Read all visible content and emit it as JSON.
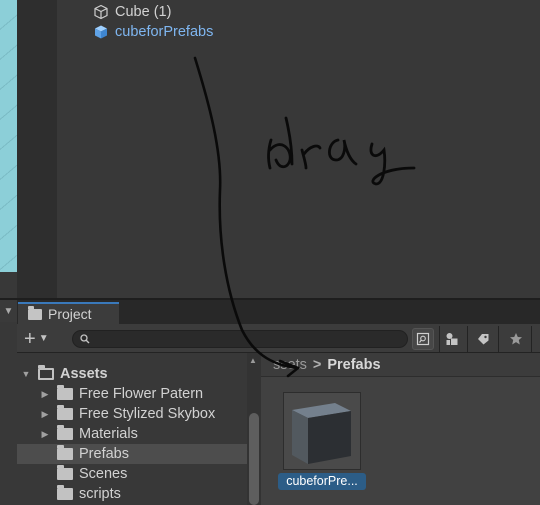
{
  "hierarchy": {
    "items": [
      {
        "label": "Cube (1)",
        "icon": "cube-outline-icon"
      },
      {
        "label": "cubeforPrefabs",
        "icon": "prefab-cube-icon",
        "color": "#7fb6f0"
      }
    ]
  },
  "annotation": {
    "text": "drag",
    "note": "hand-drawn arrow from hierarchy item to Prefabs folder"
  },
  "project": {
    "tab_label": "Project",
    "search_placeholder": "",
    "tree": [
      {
        "label": "Assets",
        "expanded": true
      },
      {
        "label": "Free Flower Patern"
      },
      {
        "label": "Free Stylized Skybox"
      },
      {
        "label": "Materials"
      },
      {
        "label": "Prefabs",
        "selected": true
      },
      {
        "label": "Scenes"
      },
      {
        "label": "scripts"
      }
    ],
    "breadcrumb": {
      "parent": "Assets",
      "visible_parent": "ssets",
      "separator": ">",
      "current": "Prefabs"
    },
    "assets": [
      {
        "label": "cubeforPre...",
        "icon": "prefab-cube-thumbnail"
      }
    ],
    "accent": "#2c5d87"
  }
}
